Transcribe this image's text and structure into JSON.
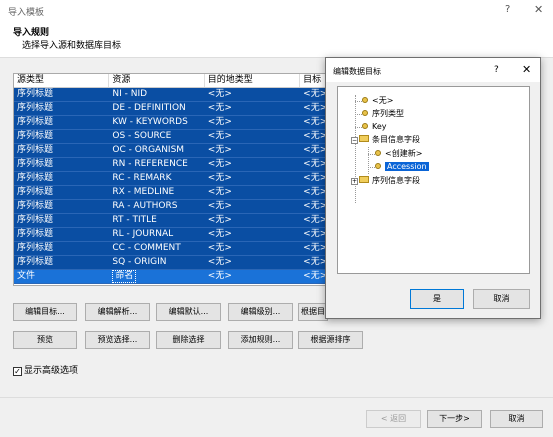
{
  "window": {
    "title": "导入模板",
    "help": "?",
    "close": "✕"
  },
  "header": {
    "title": "导入规则",
    "subtitle": "选择导入源和数据库目标"
  },
  "grid": {
    "columns": [
      "源类型",
      "资源",
      "目的地类型",
      "目标"
    ],
    "rows": [
      [
        "序列标题",
        "NI - NID",
        "<无>",
        "<无>"
      ],
      [
        "序列标题",
        "DE - DEFINITION",
        "<无>",
        "<无>"
      ],
      [
        "序列标题",
        "KW - KEYWORDS",
        "<无>",
        "<无>"
      ],
      [
        "序列标题",
        "OS - SOURCE",
        "<无>",
        "<无>"
      ],
      [
        "序列标题",
        "OC - ORGANISM",
        "<无>",
        "<无>"
      ],
      [
        "序列标题",
        "RN - REFERENCE",
        "<无>",
        "<无>"
      ],
      [
        "序列标题",
        "RC - REMARK",
        "<无>",
        "<无>"
      ],
      [
        "序列标题",
        "RX - MEDLINE",
        "<无>",
        "<无>"
      ],
      [
        "序列标题",
        "RA - AUTHORS",
        "<无>",
        "<无>"
      ],
      [
        "序列标题",
        "RT - TITLE",
        "<无>",
        "<无>"
      ],
      [
        "序列标题",
        "RL - JOURNAL",
        "<无>",
        "<无>"
      ],
      [
        "序列标题",
        "CC - COMMENT",
        "<无>",
        "<无>"
      ],
      [
        "序列标题",
        "SQ - ORIGIN",
        "<无>",
        "<无>"
      ],
      [
        "文件",
        "命名",
        "<无>",
        "<无>"
      ]
    ]
  },
  "buttons": {
    "edit_target": "编辑目标...",
    "edit_parse": "编辑解析...",
    "edit_default": "编辑默认...",
    "edit_level": "编辑级别...",
    "by_target": "根据目",
    "preview": "预览",
    "preview_select": "预览选择...",
    "delete_select": "删除选择",
    "add_rule": "添加规则...",
    "sort_by_source": "根据源排序"
  },
  "advanced": {
    "checked_mark": "☑",
    "label": "显示高级选项"
  },
  "footer": {
    "back": "< 返回",
    "next": "下一步>",
    "cancel": "取消"
  },
  "dialog": {
    "title": "编辑数据目标",
    "help": "?",
    "close": "✕",
    "tree": {
      "none": "<无>",
      "seq_type": "序列类型",
      "key": "Key",
      "entry_fields": "条目信息字段",
      "create_new": "<创建新>",
      "accession": "Accession",
      "seq_fields": "序列信息字段"
    },
    "ok": "是",
    "cancel": "取消"
  }
}
